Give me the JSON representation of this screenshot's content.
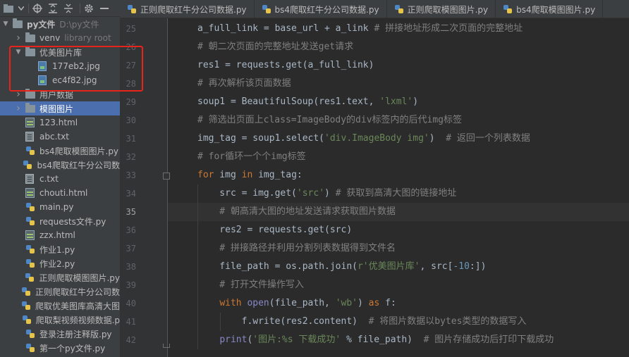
{
  "toolbar": {
    "icons": [
      "project-icon",
      "chevron-down-icon",
      "locate-icon",
      "expand-all-icon",
      "collapse-all-icon",
      "gear-icon",
      "hide-icon"
    ]
  },
  "tree": {
    "root": {
      "label": "py文件",
      "hint": "D:\\py文件"
    },
    "items": [
      {
        "label": "venv",
        "hint": "library root",
        "type": "folder"
      },
      {
        "label": "优美图片库",
        "type": "folder"
      },
      {
        "label": "177eb2.jpg",
        "type": "jpg"
      },
      {
        "label": "ec4f82.jpg",
        "type": "jpg"
      },
      {
        "label": "用户数据",
        "type": "folder"
      },
      {
        "label": "模图图片",
        "type": "folder"
      },
      {
        "label": "123.html",
        "type": "html"
      },
      {
        "label": "abc.txt",
        "type": "txt"
      },
      {
        "label": "bs4爬取模图图片.py",
        "type": "py"
      },
      {
        "label": "bs4爬取红牛分公司数",
        "type": "py"
      },
      {
        "label": "c.txt",
        "type": "txt"
      },
      {
        "label": "chouti.html",
        "type": "html"
      },
      {
        "label": "main.py",
        "type": "py"
      },
      {
        "label": "requests文件.py",
        "type": "py"
      },
      {
        "label": "zzx.html",
        "type": "html"
      },
      {
        "label": "作业1.py",
        "type": "py"
      },
      {
        "label": "作业2.py",
        "type": "py"
      },
      {
        "label": "正则爬取模图图片.py",
        "type": "py"
      },
      {
        "label": "正则爬取红牛分公司数",
        "type": "py"
      },
      {
        "label": "爬取优美图库高清大图",
        "type": "py"
      },
      {
        "label": "爬取梨视频视频数据.p",
        "type": "py"
      },
      {
        "label": "登录注册注释版.py",
        "type": "py"
      },
      {
        "label": "第一个py文件.py",
        "type": "py"
      }
    ]
  },
  "tabs": [
    {
      "label": "正则爬取红牛分公司数据.py"
    },
    {
      "label": "bs4爬取红牛分公司数据.py"
    },
    {
      "label": "正则爬取模图图片.py"
    },
    {
      "label": "bs4爬取模图图片.py"
    }
  ],
  "editor": {
    "line_numbers": [
      "25",
      "26",
      "27",
      "28",
      "29",
      "30",
      "31",
      "32",
      "33",
      "34",
      "35",
      "36",
      "37",
      "38",
      "39",
      "40",
      "41",
      "42"
    ],
    "current_line": "35",
    "lines": [
      [
        {
          "t": "a_full_link = base_url + a_link",
          "c": "fn"
        },
        {
          "t": " # 拼接地址形成二次页面的完整地址",
          "c": "cmt"
        }
      ],
      [
        {
          "t": "# 朝二次页面的完整地址发送get请求",
          "c": "cmt"
        }
      ],
      [
        {
          "t": "res1 = requests.get(a_full_link)",
          "c": "fn"
        }
      ],
      [
        {
          "t": "# 再次解析该页面数据",
          "c": "cmt"
        }
      ],
      [
        {
          "t": "soup1 = BeautifulSoup(res1.text, ",
          "c": "fn"
        },
        {
          "t": "'lxml'",
          "c": "str"
        },
        {
          "t": ")",
          "c": "fn"
        }
      ],
      [
        {
          "t": "# 筛选出页面上class=ImageBody的div标签内的后代img标签",
          "c": "cmt"
        }
      ],
      [
        {
          "t": "img_tag = soup1.select(",
          "c": "fn"
        },
        {
          "t": "'div.ImageBody img'",
          "c": "str"
        },
        {
          "t": ")  ",
          "c": "fn"
        },
        {
          "t": "# 返回一个列表数据",
          "c": "cmt"
        }
      ],
      [
        {
          "t": "# for循环一个个img标签",
          "c": "cmt"
        }
      ],
      [
        {
          "t": "for",
          "c": "kw"
        },
        {
          "t": " img ",
          "c": "fn"
        },
        {
          "t": "in",
          "c": "kw"
        },
        {
          "t": " img_tag:",
          "c": "fn"
        }
      ],
      [
        {
          "t": "    src = img.get(",
          "c": "fn"
        },
        {
          "t": "'src'",
          "c": "str"
        },
        {
          "t": ") ",
          "c": "fn"
        },
        {
          "t": "# 获取到高清大图的链接地址",
          "c": "cmt"
        }
      ],
      [
        {
          "t": "    # 朝高清大图的地址发送请求获取图片数据",
          "c": "cmt"
        }
      ],
      [
        {
          "t": "    res2 = requests.get(src)",
          "c": "fn"
        }
      ],
      [
        {
          "t": "    # 拼接路径并利用分割列表数据得到文件名",
          "c": "cmt"
        }
      ],
      [
        {
          "t": "    file_path = os.path.join(",
          "c": "fn"
        },
        {
          "t": "r'优美图片库'",
          "c": "str"
        },
        {
          "t": ", src[",
          "c": "fn"
        },
        {
          "t": "-10",
          "c": "num"
        },
        {
          "t": ":])",
          "c": "fn"
        }
      ],
      [
        {
          "t": "    # 打开文件操作写入",
          "c": "cmt"
        }
      ],
      [
        {
          "t": "    ",
          "c": "fn"
        },
        {
          "t": "with",
          "c": "kw"
        },
        {
          "t": " ",
          "c": "fn"
        },
        {
          "t": "open",
          "c": "bi"
        },
        {
          "t": "(file_path, ",
          "c": "fn"
        },
        {
          "t": "'wb'",
          "c": "str"
        },
        {
          "t": ") ",
          "c": "fn"
        },
        {
          "t": "as",
          "c": "kw"
        },
        {
          "t": " f:",
          "c": "fn"
        }
      ],
      [
        {
          "t": "        f.write(res2.content)  ",
          "c": "fn"
        },
        {
          "t": "# 将图片数据以bytes类型的数据写入",
          "c": "cmt"
        }
      ],
      [
        {
          "t": "    ",
          "c": "fn"
        },
        {
          "t": "print",
          "c": "bi"
        },
        {
          "t": "(",
          "c": "fn"
        },
        {
          "t": "'图片:%s 下载成功'",
          "c": "str"
        },
        {
          "t": " % file_path)  ",
          "c": "fn"
        },
        {
          "t": "# 图片存储成功后打印下载成功",
          "c": "cmt"
        }
      ]
    ]
  },
  "colors": {
    "keyword": "#cc7832",
    "string": "#6a8759",
    "comment": "#808080",
    "number": "#6897bb",
    "builtin": "#8888c6",
    "selection": "#4b6eaf",
    "annotation_box": "#e8231a"
  }
}
